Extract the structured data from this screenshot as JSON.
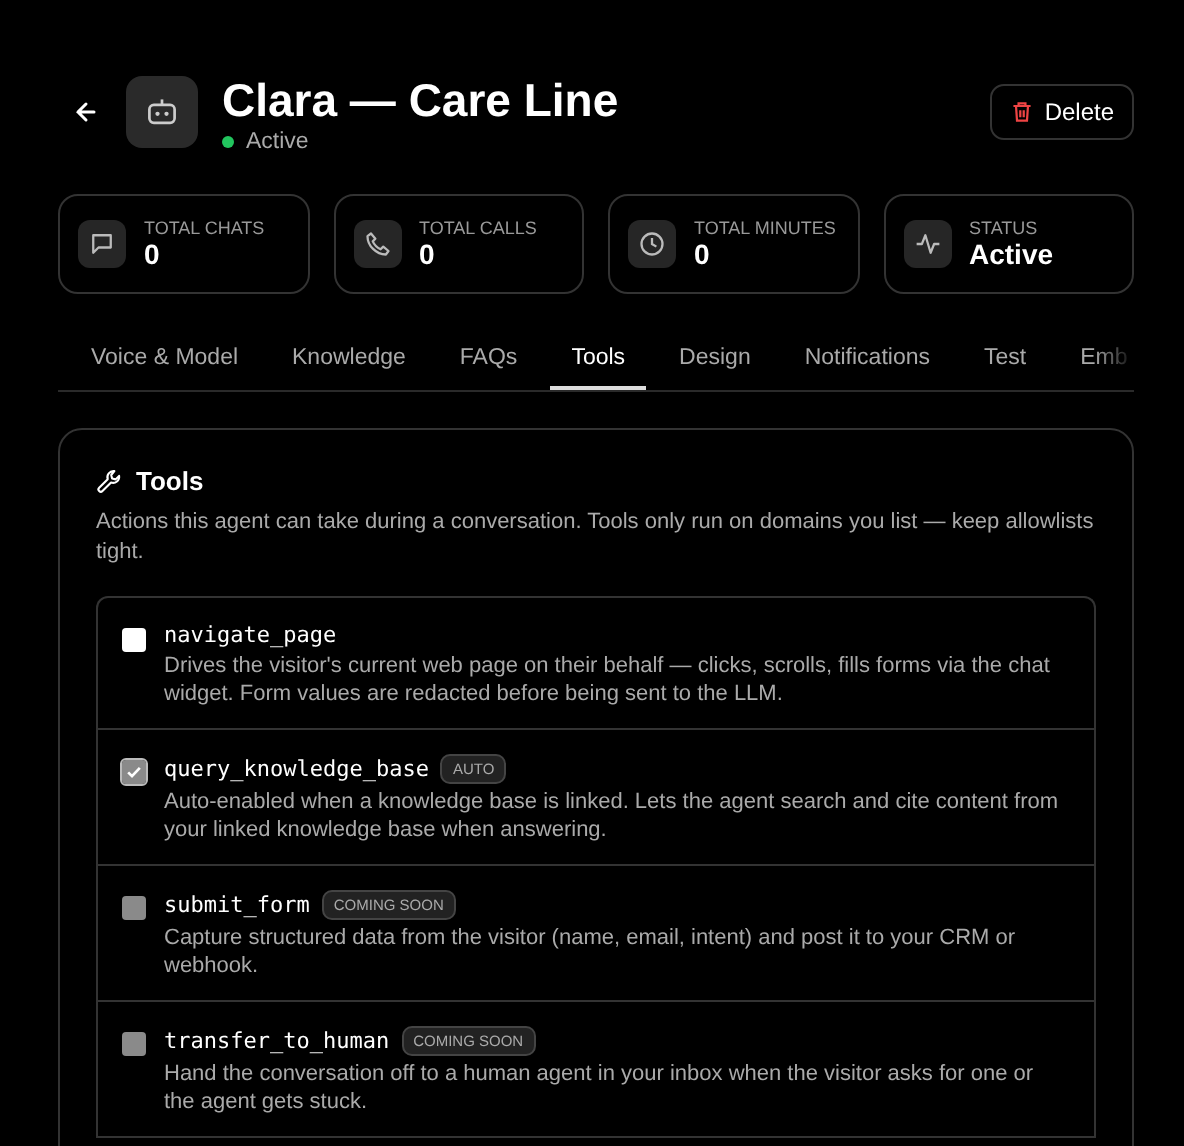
{
  "header": {
    "title": "Clara — Care Line",
    "status": {
      "label": "Active",
      "color": "#22c55e"
    },
    "delete_button": "Delete"
  },
  "stats": [
    {
      "kind": "chat",
      "label": "TOTAL CHATS",
      "value": "0"
    },
    {
      "kind": "phone",
      "label": "TOTAL CALLS",
      "value": "0"
    },
    {
      "kind": "clock",
      "label": "TOTAL MINUTES",
      "value": "0"
    },
    {
      "kind": "pulse",
      "label": "STATUS",
      "value": "Active"
    }
  ],
  "tabs": [
    {
      "label": "Voice & Model",
      "selected": false
    },
    {
      "label": "Knowledge",
      "selected": false
    },
    {
      "label": "FAQs",
      "selected": false
    },
    {
      "label": "Tools",
      "selected": true
    },
    {
      "label": "Design",
      "selected": false
    },
    {
      "label": "Notifications",
      "selected": false
    },
    {
      "label": "Test",
      "selected": false
    },
    {
      "label": "Emb",
      "selected": false
    }
  ],
  "section": {
    "title": "Tools",
    "description": "Actions this agent can take during a conversation. Tools only run on domains you list — keep allowlists tight."
  },
  "tools": [
    {
      "name": "navigate_page",
      "checked": false,
      "disabled": false,
      "description": "Drives the visitor's current web page on their behalf — clicks, scrolls, fills forms via the chat widget. Form values are redacted before being sent to the LLM."
    },
    {
      "name": "query_knowledge_base",
      "badge": "AUTO",
      "checked": true,
      "disabled": true,
      "description": "Auto-enabled when a knowledge base is linked. Lets the agent search and cite content from your linked knowledge base when answering."
    },
    {
      "name": "submit_form",
      "badge": "COMING SOON",
      "checked": false,
      "disabled": true,
      "description": "Capture structured data from the visitor (name, email, intent) and post it to your CRM or webhook."
    },
    {
      "name": "transfer_to_human",
      "badge": "COMING SOON",
      "checked": false,
      "disabled": true,
      "description": "Hand the conversation off to a human agent in your inbox when the visitor asks for one or the agent gets stuck."
    }
  ]
}
